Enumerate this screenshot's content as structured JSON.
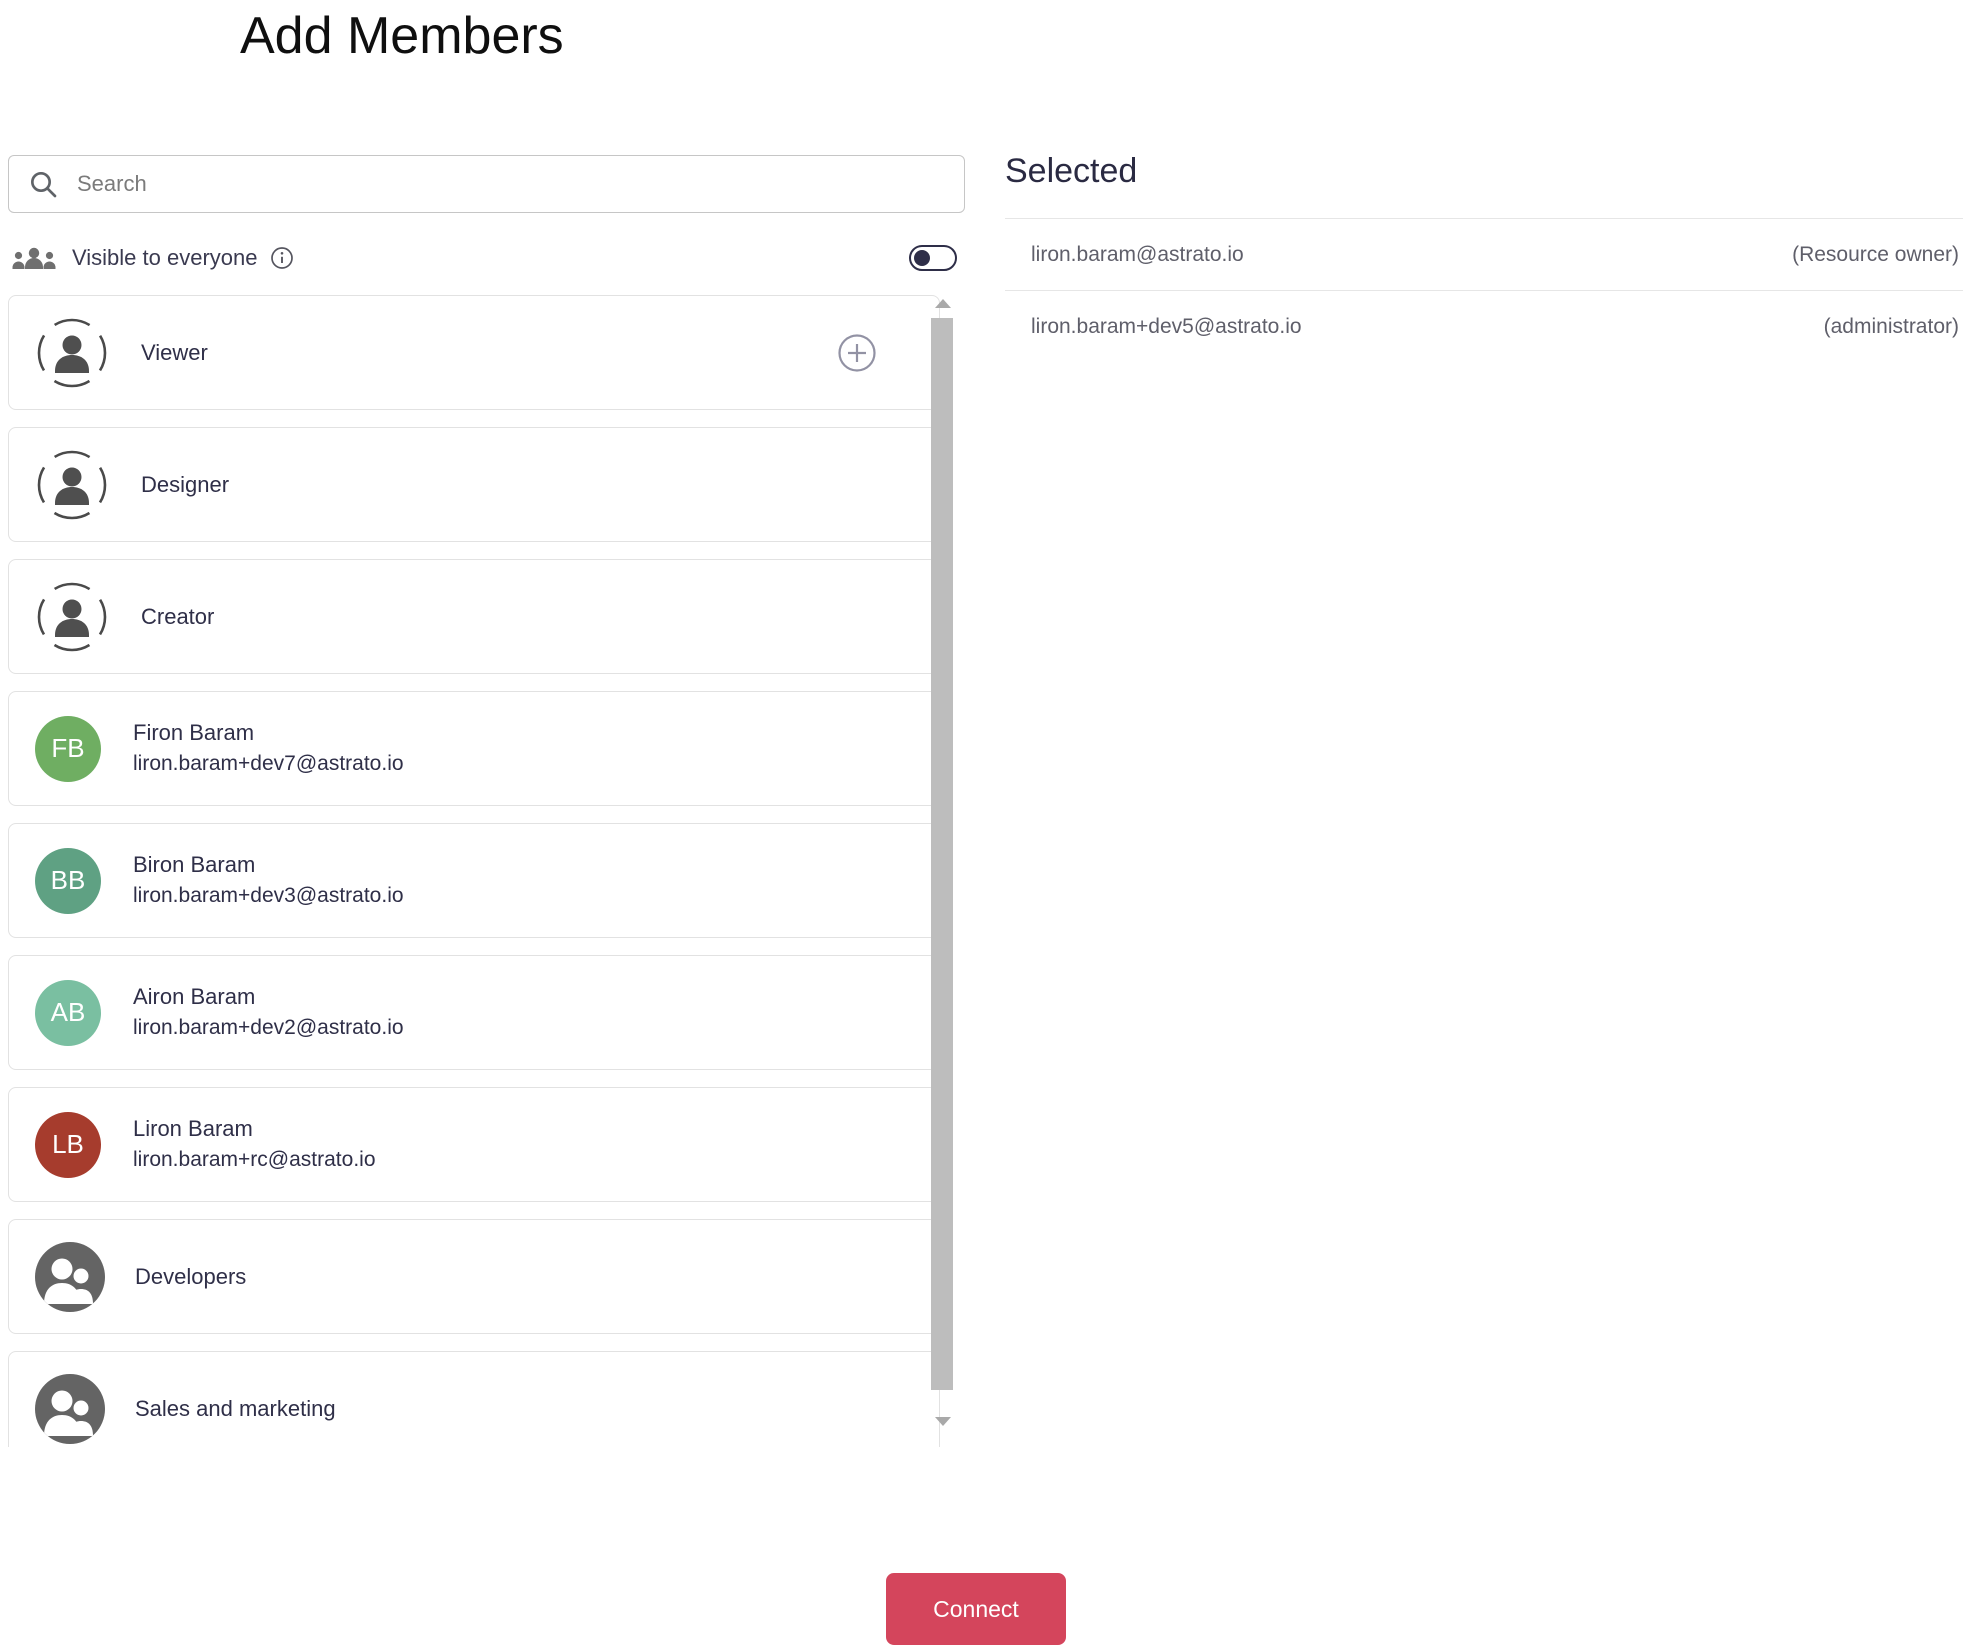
{
  "title": "Add Members",
  "search": {
    "placeholder": "Search"
  },
  "visibility": {
    "label": "Visible to everyone",
    "toggle_state": "off"
  },
  "member_list": {
    "items": [
      {
        "type": "role",
        "label": "Viewer",
        "has_add_button": true
      },
      {
        "type": "role",
        "label": "Designer"
      },
      {
        "type": "role",
        "label": "Creator"
      },
      {
        "type": "user",
        "initials": "FB",
        "name": "Firon Baram",
        "email": "liron.baram+dev7@astrato.io",
        "avatar_color": "#6FAE62"
      },
      {
        "type": "user",
        "initials": "BB",
        "name": "Biron Baram",
        "email": "liron.baram+dev3@astrato.io",
        "avatar_color": "#5FA183"
      },
      {
        "type": "user",
        "initials": "AB",
        "name": "Airon Baram",
        "email": "liron.baram+dev2@astrato.io",
        "avatar_color": "#7ABFA1"
      },
      {
        "type": "user",
        "initials": "LB",
        "name": "Liron Baram",
        "email": "liron.baram+rc@astrato.io",
        "avatar_color": "#A63C2D"
      },
      {
        "type": "group",
        "label": "Developers"
      },
      {
        "type": "group",
        "label": "Sales and marketing"
      }
    ]
  },
  "selected_panel": {
    "heading": "Selected",
    "rows": [
      {
        "email": "liron.baram@astrato.io",
        "role": "(Resource owner)"
      },
      {
        "email": "liron.baram+dev5@astrato.io",
        "role": "(administrator)"
      }
    ]
  },
  "footer": {
    "connect_label": "Connect"
  },
  "colors": {
    "accent": "#D4455C",
    "toggle": "#2E2E48",
    "group_avatar": "#646464",
    "scrollbar_thumb": "#BDBDBD"
  }
}
